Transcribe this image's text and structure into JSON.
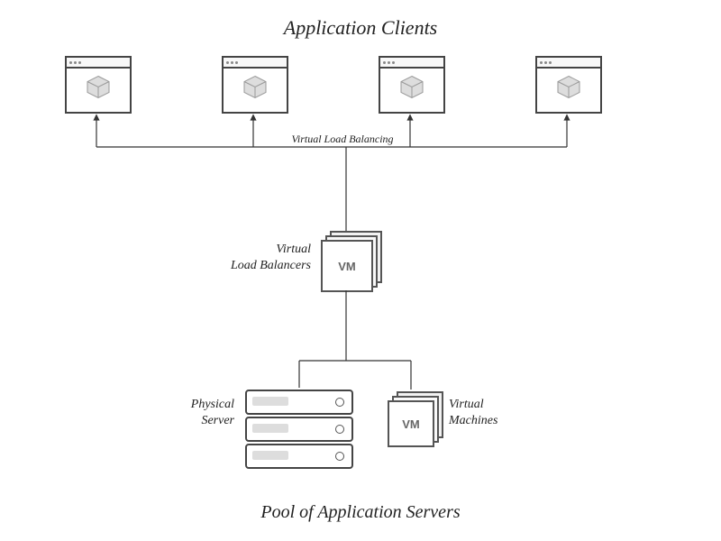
{
  "titles": {
    "top": "Application Clients",
    "bottom": "Pool of Application Servers"
  },
  "labels": {
    "routing": "Virtual Load Balancing",
    "lb": "Virtual\nLoad Balancers",
    "physical": "Physical\nServer",
    "vms": "Virtual\nMachines"
  },
  "glyphs": {
    "vm": "VM"
  }
}
